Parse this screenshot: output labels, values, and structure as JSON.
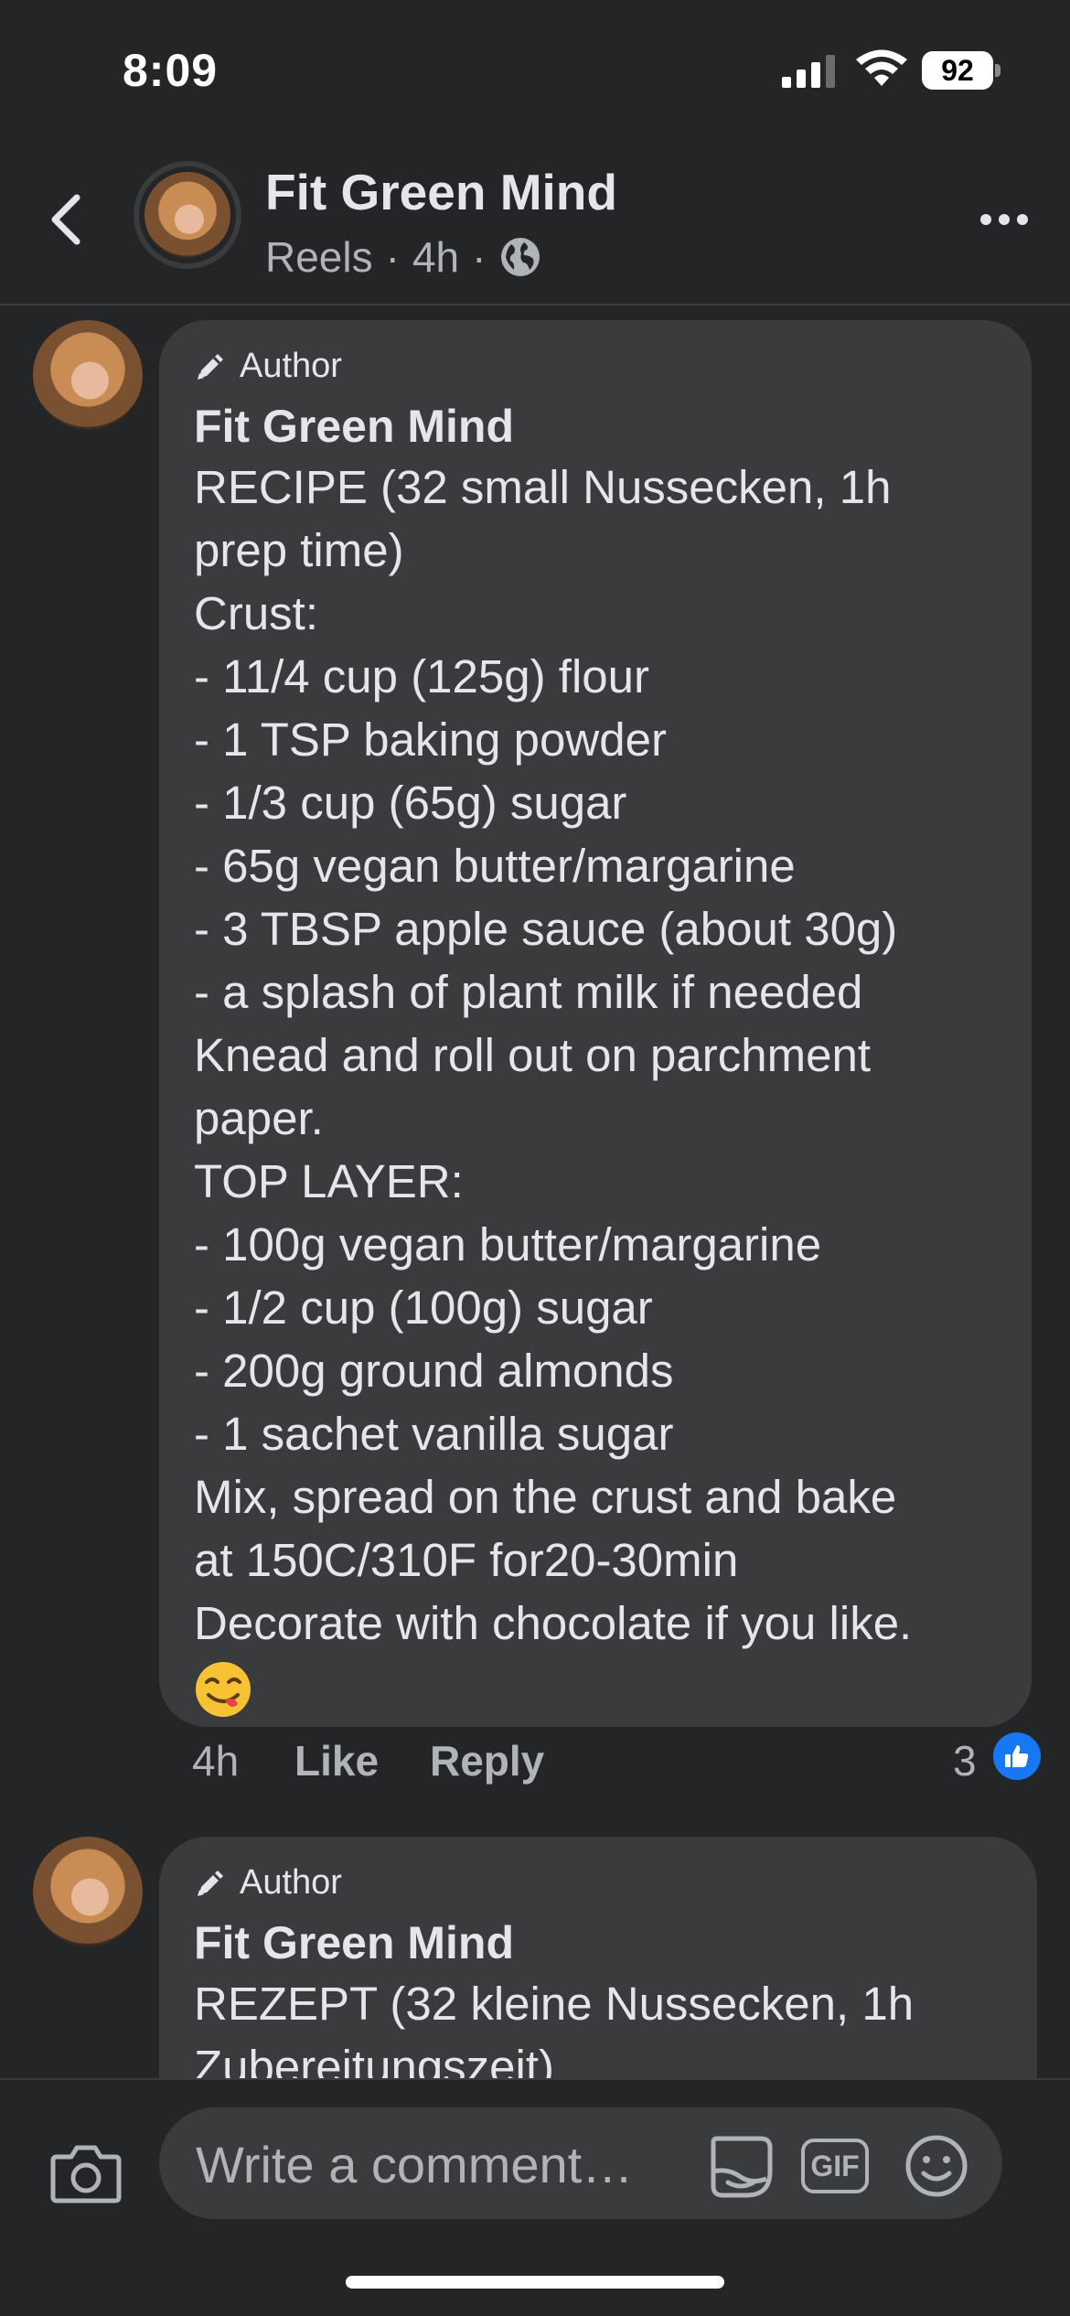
{
  "status_bar": {
    "time": "8:09",
    "battery": "92"
  },
  "header": {
    "title": "Fit Green Mind",
    "subtitle_source": "Reels",
    "subtitle_sep1": "·",
    "subtitle_age": "4h",
    "subtitle_sep2": "·",
    "privacy_icon": "globe-icon",
    "back_icon": "chevron-left-icon",
    "more_icon": "more-horizontal-icon"
  },
  "comments": [
    {
      "badge": "Author",
      "name": "Fit Green Mind",
      "lines": [
        "RECIPE (32 small Nussecken, 1h",
        "prep time)",
        "Crust:",
        "- 11/4 cup (125g) flour",
        "- 1 TSP baking powder",
        "- 1/3 cup (65g) sugar",
        "- 65g vegan butter/margarine",
        "- 3 TBSP apple sauce (about 30g)",
        "- a splash of plant milk if needed",
        "Knead and roll out on parchment",
        "paper.",
        "TOP LAYER:",
        "- 100g vegan butter/margarine",
        "- 1/2 cup (100g) sugar",
        "- 200g ground almonds",
        "- 1 sachet vanilla sugar",
        "Mix, spread on the crust and bake",
        "at 150C/310F for20-30min",
        "Decorate with chocolate if you like."
      ],
      "emoji": "yum-face-emoji",
      "time": "4h",
      "like_label": "Like",
      "reply_label": "Reply",
      "reaction_count": "3"
    },
    {
      "badge": "Author",
      "name": "Fit Green Mind",
      "lines": [
        "REZEPT (32 kleine Nussecken, 1h",
        "Zubereitungszeit)"
      ]
    }
  ],
  "composer": {
    "placeholder": "Write a comment…",
    "gif_label": "GIF"
  },
  "colors": {
    "background": "#242526",
    "bubble": "#3a3b3c",
    "text_primary": "#e4e6eb",
    "text_secondary": "#b0b3b8",
    "like_blue": "#1877f2"
  }
}
